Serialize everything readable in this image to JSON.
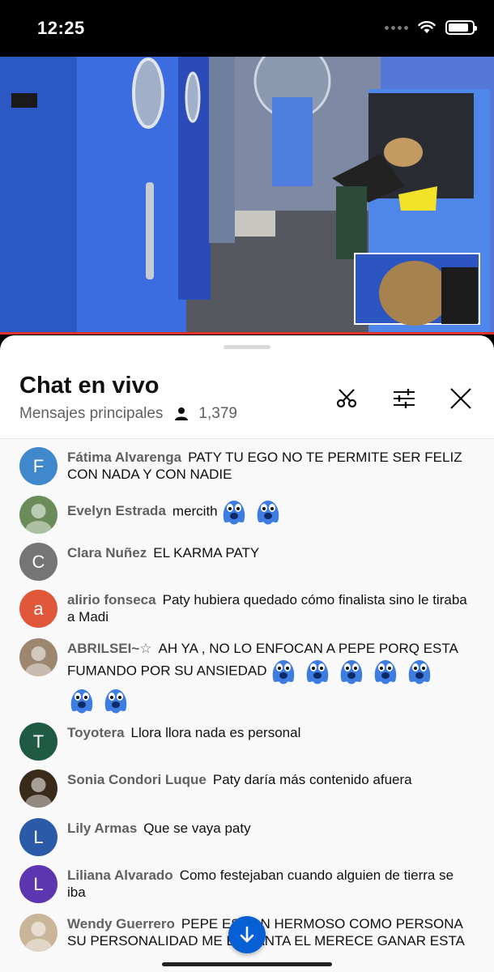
{
  "status_bar": {
    "time": "12:25"
  },
  "chat": {
    "title": "Chat en vivo",
    "mode": "Mensajes principales",
    "viewers": "1,379"
  },
  "messages": [
    {
      "author": "Fátima Alvarenga",
      "avatar_letter": "F",
      "avatar_color": "#3f88cc",
      "text": "PATY TU EGO NO TE PERMITE SER FELIZ CON NADA Y CON NADIE",
      "emojis": 0
    },
    {
      "author": "Evelyn Estrada",
      "avatar_letter": "",
      "avatar_color": "#6b8c5a",
      "text": "mercith",
      "emojis": 2
    },
    {
      "author": "Clara Nuñez",
      "avatar_letter": "C",
      "avatar_color": "#757575",
      "text": "EL KARMA PATY",
      "emojis": 0
    },
    {
      "author": "alirio fonseca",
      "avatar_letter": "a",
      "avatar_color": "#e0573a",
      "text": "Paty hubiera quedado cómo finalista sino le tiraba a Madi",
      "emojis": 0
    },
    {
      "author": "ABRILSEI~☆",
      "avatar_letter": "",
      "avatar_color": "#9c8670",
      "text": "AH YA , NO LO ENFOCAN A PEPE PORQ ESTA FUMANDO POR SU ANSIEDAD",
      "emojis": 7
    },
    {
      "author": "Toyotera",
      "avatar_letter": "T",
      "avatar_color": "#1e5a44",
      "text": "Llora llora nada es personal",
      "emojis": 0
    },
    {
      "author": "Sonia Condori Luque",
      "avatar_letter": "",
      "avatar_color": "#3a2a1a",
      "text": "Paty daría más contenido afuera",
      "emojis": 0
    },
    {
      "author": "Lily Armas",
      "avatar_letter": "L",
      "avatar_color": "#2a5aa8",
      "text": "Que se vaya paty",
      "emojis": 0
    },
    {
      "author": "Liliana Alvarado",
      "avatar_letter": "L",
      "avatar_color": "#5e35b1",
      "text": "Como festejaban cuando alguien de tierra se iba",
      "emojis": 0
    },
    {
      "author": "Wendy Guerrero",
      "avatar_letter": "",
      "avatar_color": "#c9b59a",
      "text": "PEPE ES TAN HERMOSO COMO PERSONA SU PERSONALIDAD ME ENCANTA EL MERECE GANAR ESTA",
      "emojis": 0
    }
  ]
}
